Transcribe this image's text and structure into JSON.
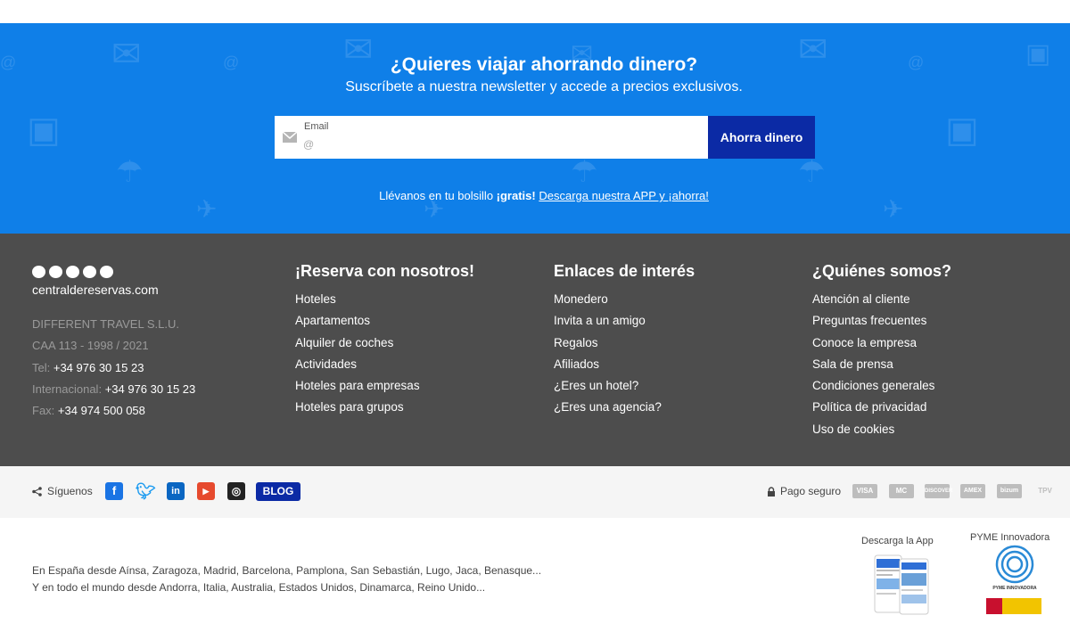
{
  "newsletter": {
    "title": "¿Quieres viajar ahorrando dinero?",
    "subtitle": "Suscríbete a nuestra newsletter y accede a precios exclusivos.",
    "email_label": "Email",
    "email_placeholder": "@",
    "button_label": "Ahorra dinero",
    "app_prefix": "Llévanos en tu bolsillo ",
    "app_bold": "¡gratis!",
    "app_link": "Descarga nuestra APP y ¡ahorra!"
  },
  "company": {
    "logo_text": "centraldereservas.com",
    "name": "DIFFERENT TRAVEL S.L.U.",
    "caa": "CAA 113 - 1998 / 2021",
    "tel_label": "Tel:",
    "tel": "+34 976 30 15 23",
    "intl_label": "Internacional:",
    "intl": "+34 976 30 15 23",
    "fax_label": "Fax:",
    "fax": "+34 974 500 058"
  },
  "columns": [
    {
      "title": "¡Reserva con nosotros!",
      "items": [
        "Hoteles",
        "Apartamentos",
        "Alquiler de coches",
        "Actividades",
        "Hoteles para empresas",
        "Hoteles para grupos"
      ]
    },
    {
      "title": "Enlaces de interés",
      "items": [
        "Monedero",
        "Invita a un amigo",
        "Regalos",
        "Afiliados",
        "¿Eres un hotel?",
        "¿Eres una agencia?"
      ]
    },
    {
      "title": "¿Quiénes somos?",
      "items": [
        "Atención al cliente",
        "Preguntas frecuentes",
        "Conoce la empresa",
        "Sala de prensa",
        "Condiciones generales",
        "Política de privacidad",
        "Uso de cookies"
      ]
    }
  ],
  "social": {
    "share_label": "Síguenos",
    "blog_label": "BLOG",
    "secure_label": "Pago seguro",
    "cards": [
      "VISA",
      "MC",
      "DISCOVER",
      "AMEX",
      "bizum",
      "TPV"
    ]
  },
  "bottom": {
    "cities_line1": "En España desde Aínsa, Zaragoza, Madrid, Barcelona, Pamplona, San Sebastián, Lugo, Jaca, Benasque...",
    "cities_line2": "Y en todo el mundo desde Andorra, Italia, Australia, Estados Unidos, Dinamarca, Reino Unido...",
    "download_app": "Descarga la App",
    "pyme": "PYME Innovadora",
    "pyme_badge": "PYME INNOVADORA"
  },
  "colors": {
    "newsletter_bg": "#0f7fe8",
    "button_bg": "#0b2aa5",
    "footer_bg": "#4d4d4d",
    "facebook": "#1a74e4",
    "twitter": "#1d9bf0",
    "linkedin": "#0a66c2",
    "youtube": "#e64a2e",
    "instagram": "#222222"
  }
}
